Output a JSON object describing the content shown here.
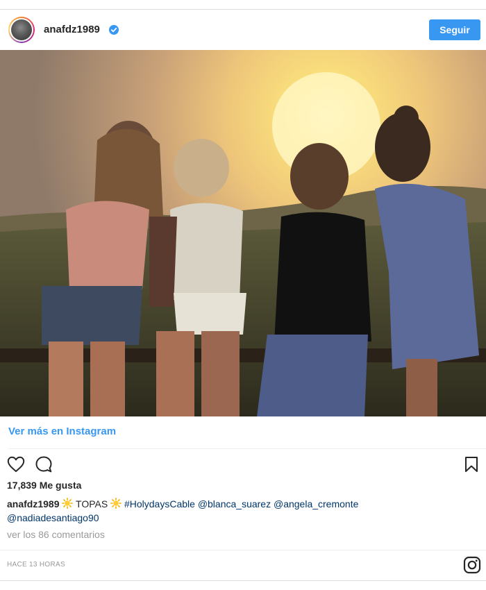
{
  "header": {
    "username": "anafdz1989",
    "verified": true,
    "follow_label": "Seguir"
  },
  "post": {
    "image_description_icon": "group-photo-sunset",
    "view_more_label": "Ver más en Instagram",
    "likes_text": "17,839 Me gusta",
    "caption": {
      "username": "anafdz1989",
      "text": "TOPAS",
      "hashtag": "#HolydaysCable",
      "mentions": [
        "@blanca_suarez",
        "@angela_cremonte",
        "@nadiadesantiago90"
      ]
    },
    "comments_link": "ver los 86 comentarios",
    "timestamp": "HACE 13 HORAS"
  },
  "colors": {
    "accent": "#3897f0",
    "link": "#003569",
    "muted": "#999999"
  }
}
